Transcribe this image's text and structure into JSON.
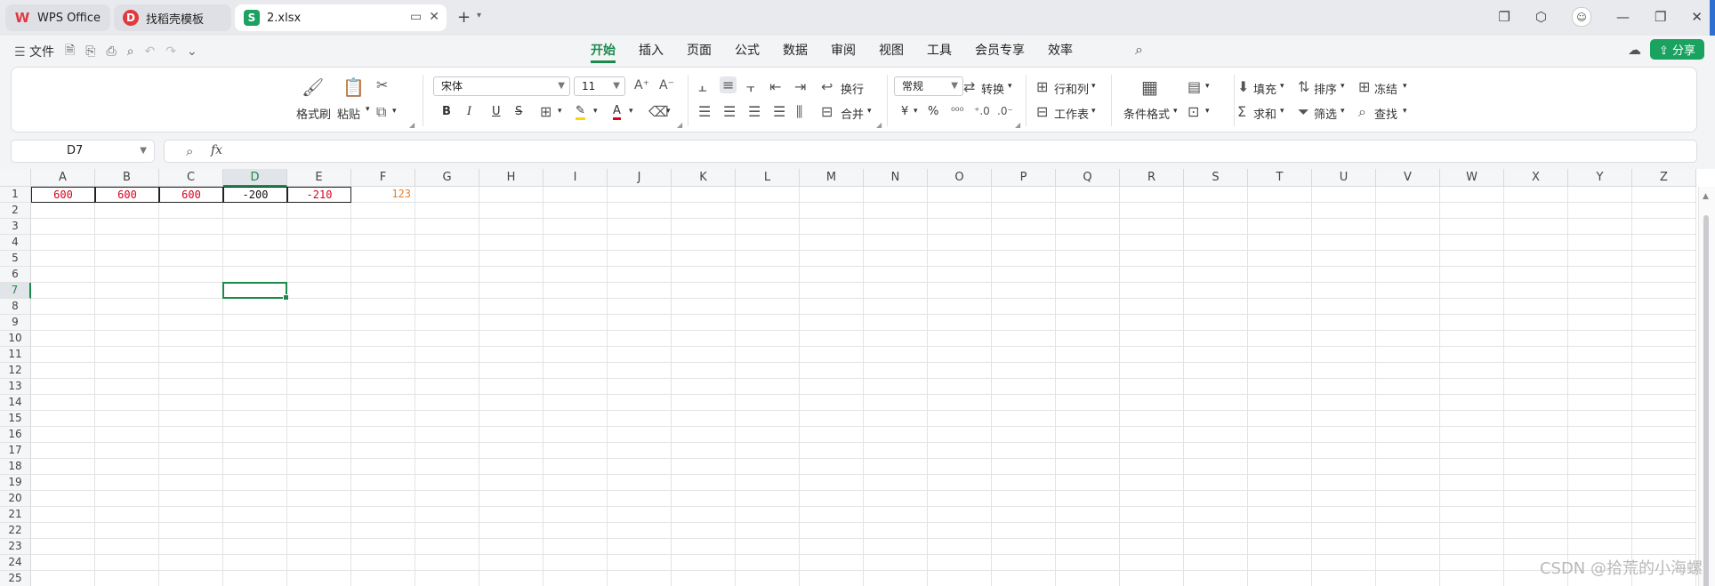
{
  "tabs": [
    {
      "label": "WPS Office",
      "logo": "W"
    },
    {
      "label": "找稻壳模板",
      "logo": "D"
    },
    {
      "label": "2.xlsx",
      "logo": "S"
    }
  ],
  "menu": {
    "file": "文件",
    "tabs": [
      "开始",
      "插入",
      "页面",
      "公式",
      "数据",
      "审阅",
      "视图",
      "工具",
      "会员专享",
      "效率"
    ],
    "active_tab": "开始",
    "share": "分享"
  },
  "ribbon": {
    "format_painter": "格式刷",
    "paste": "粘贴",
    "font_name": "宋体",
    "font_size": "11",
    "wrap": "换行",
    "merge": "合并",
    "number_format": "常规",
    "convert": "转换",
    "rows_cols": "行和列",
    "worksheet": "工作表",
    "cond_format": "条件格式",
    "fill": "填充",
    "sort": "排序",
    "freeze": "冻结",
    "sum": "求和",
    "filter": "筛选",
    "find": "查找",
    "bold": "B",
    "italic": "I",
    "underline": "U",
    "strike": "S",
    "font_color_glyph": "A",
    "currency": "¥",
    "percent": "%"
  },
  "formula_bar": {
    "name_box": "D7",
    "fx": "fx",
    "content": ""
  },
  "columns": [
    "A",
    "B",
    "C",
    "D",
    "E",
    "F",
    "G",
    "H",
    "I",
    "J",
    "K",
    "L",
    "M",
    "N",
    "O",
    "P",
    "Q",
    "R",
    "S",
    "T",
    "U",
    "V",
    "W",
    "X",
    "Y",
    "Z"
  ],
  "rows": [
    "1",
    "2",
    "3",
    "4",
    "5",
    "6",
    "7",
    "8",
    "9",
    "10",
    "11",
    "12",
    "13",
    "14",
    "15",
    "16",
    "17",
    "18",
    "19",
    "20",
    "21",
    "22",
    "23",
    "24",
    "25"
  ],
  "cells": {
    "A1": "600",
    "B1": "600",
    "C1": "600",
    "D1": "-200",
    "E1": "-210",
    "F1": "123"
  },
  "selected_cell": "D7",
  "colors": {
    "accent": "#1b8a4d",
    "red_text": "#d9001b",
    "orange_text": "#e8802a"
  },
  "watermark": "CSDN @拾荒的小海螺"
}
